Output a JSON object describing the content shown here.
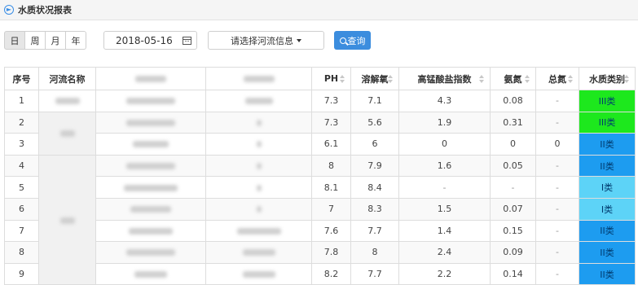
{
  "header": {
    "title": "水质状况报表"
  },
  "toolbar": {
    "period_buttons": [
      "日",
      "周",
      "月",
      "年"
    ],
    "active_period": "日",
    "date_value": "2018-05-16",
    "river_select_label": "请选择河流信息",
    "query_label": "查询"
  },
  "table": {
    "columns": [
      "序号",
      "河流名称",
      "",
      "",
      "PH",
      "溶解氧",
      "高锰酸盐指数",
      "氨氮",
      "总氮",
      "水质类别"
    ],
    "rows": [
      {
        "no": "1",
        "ph": "7.3",
        "do": "7.1",
        "codmn": "4.3",
        "nh3n": "0.08",
        "tn": "-",
        "class": "III类",
        "class_color": "#1de81d"
      },
      {
        "no": "2",
        "ph": "7.3",
        "do": "5.6",
        "codmn": "1.9",
        "nh3n": "0.31",
        "tn": "-",
        "class": "III类",
        "class_color": "#1de81d"
      },
      {
        "no": "3",
        "ph": "6.1",
        "do": "6",
        "codmn": "0",
        "nh3n": "0",
        "tn": "0",
        "class": "II类",
        "class_color": "#1d9cf0"
      },
      {
        "no": "4",
        "ph": "8",
        "do": "7.9",
        "codmn": "1.6",
        "nh3n": "0.05",
        "tn": "-",
        "class": "II类",
        "class_color": "#1d9cf0"
      },
      {
        "no": "5",
        "ph": "8.1",
        "do": "8.4",
        "codmn": "-",
        "nh3n": "-",
        "tn": "-",
        "class": "I类",
        "class_color": "#5dd3f7"
      },
      {
        "no": "6",
        "ph": "7",
        "do": "8.3",
        "codmn": "1.5",
        "nh3n": "0.07",
        "tn": "-",
        "class": "I类",
        "class_color": "#5dd3f7"
      },
      {
        "no": "7",
        "ph": "7.6",
        "do": "7.7",
        "codmn": "1.4",
        "nh3n": "0.15",
        "tn": "-",
        "class": "II类",
        "class_color": "#1d9cf0"
      },
      {
        "no": "8",
        "ph": "7.8",
        "do": "8",
        "codmn": "2.4",
        "nh3n": "0.09",
        "tn": "-",
        "class": "II类",
        "class_color": "#1d9cf0"
      },
      {
        "no": "9",
        "ph": "8.2",
        "do": "7.7",
        "codmn": "2.2",
        "nh3n": "0.14",
        "tn": "-",
        "class": "II类",
        "class_color": "#1d9cf0"
      }
    ]
  }
}
